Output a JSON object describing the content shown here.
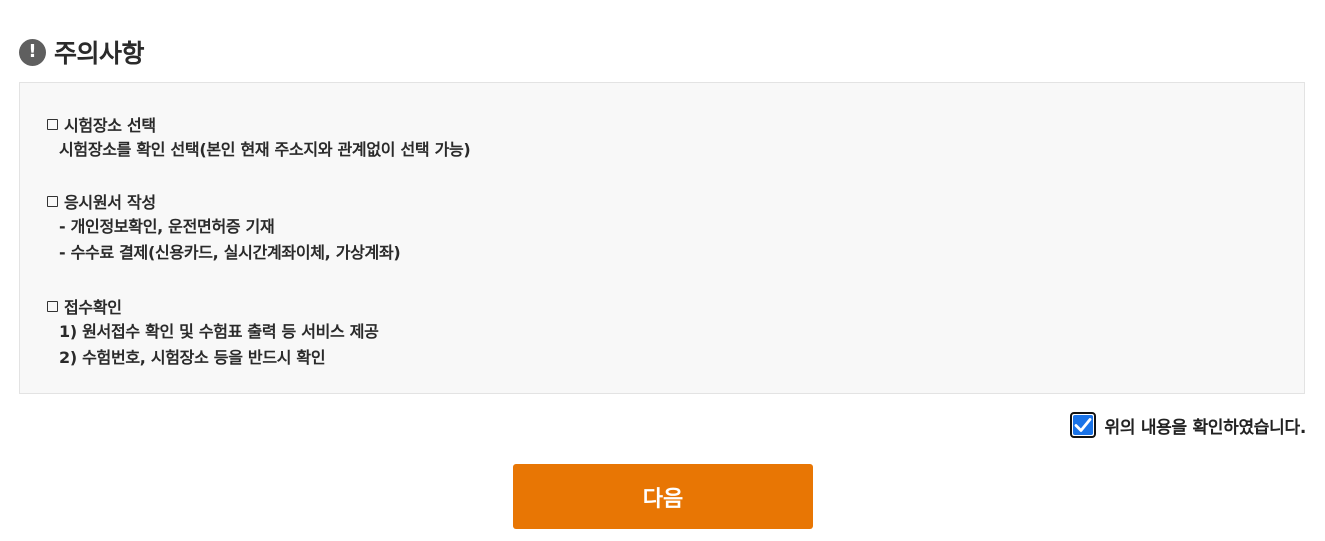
{
  "header": {
    "icon": "exclamation-circle-icon",
    "icon_glyph": "!",
    "title": "주의사항"
  },
  "notice": {
    "sections": [
      {
        "heading": "시험장소 선택",
        "lines": [
          "시험장소를 확인 선택(본인 현재 주소지와 관계없이 선택 가능)"
        ]
      },
      {
        "heading": "응시원서 작성",
        "lines": [
          "- 개인정보확인, 운전면허증 기재",
          "- 수수료 결제(신용카드, 실시간계좌이체, 가상계좌)"
        ]
      },
      {
        "heading": "접수확인",
        "lines": [
          "1) 원서접수 확인 및 수험표 출력 등 서비스 제공",
          "2) 수험번호, 시험장소 등을 반드시 확인"
        ]
      }
    ]
  },
  "confirm": {
    "checked": true,
    "label": "위의 내용을 확인하였습니다."
  },
  "next_button": {
    "label": "다음"
  },
  "colors": {
    "accent": "#e87604",
    "checkbox": "#1a73e8",
    "box_background": "#f8f8f8"
  }
}
